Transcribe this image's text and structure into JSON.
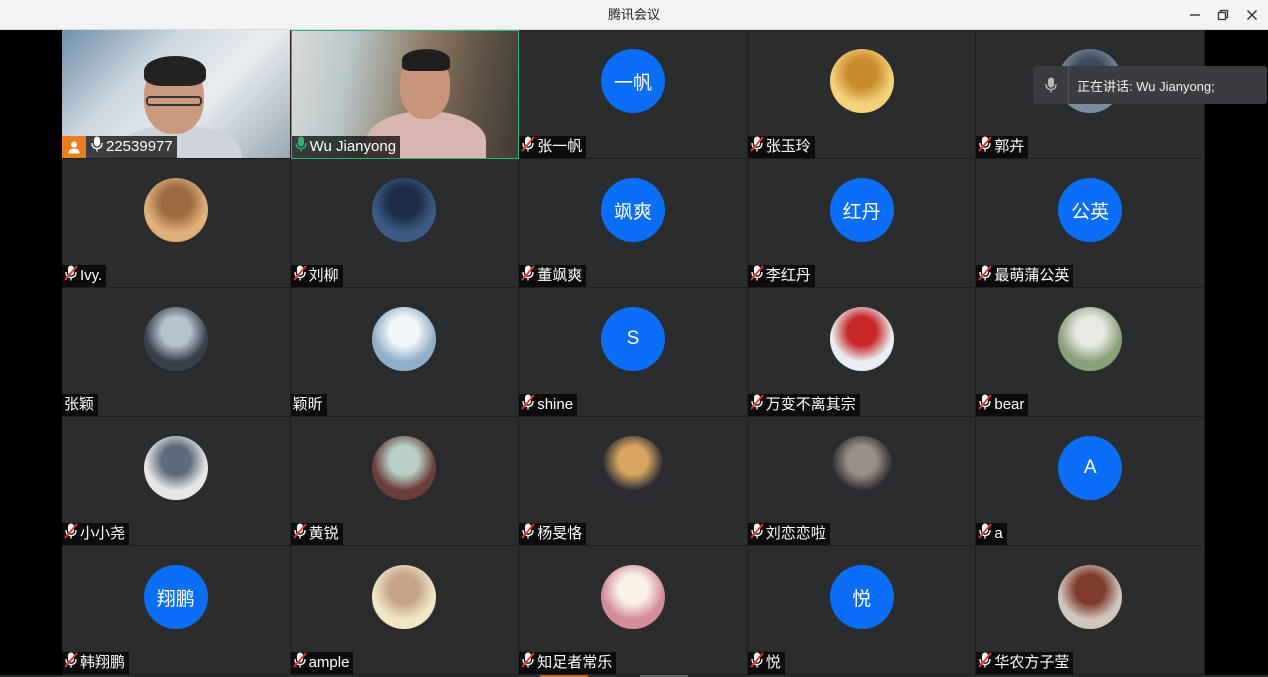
{
  "window": {
    "title": "腾讯会议"
  },
  "speaking": {
    "text": "正在讲话: Wu Jianyong;"
  },
  "colors": {
    "avatar_blue": "#0a6ef7",
    "host_badge": "#ef7c1b",
    "active_border": "#2fb36f"
  },
  "participants": [
    {
      "name": "22539977",
      "kind": "video",
      "mic": "on",
      "host": true
    },
    {
      "name": "Wu Jianyong",
      "kind": "video",
      "mic": "speaking"
    },
    {
      "name": "张一帆",
      "kind": "text",
      "avatar_text": "一帆",
      "mic": "muted"
    },
    {
      "name": "张玉玲",
      "kind": "image",
      "mic": "muted"
    },
    {
      "name": "郭卉",
      "kind": "image",
      "mic": "muted"
    },
    {
      "name": "Ivy.",
      "kind": "image",
      "mic": "muted"
    },
    {
      "name": "刘柳",
      "kind": "image",
      "mic": "muted"
    },
    {
      "name": "董飒爽",
      "kind": "text",
      "avatar_text": "飒爽",
      "mic": "muted"
    },
    {
      "name": "李红丹",
      "kind": "text",
      "avatar_text": "红丹",
      "mic": "muted"
    },
    {
      "name": "最萌蒲公英",
      "kind": "text",
      "avatar_text": "公英",
      "mic": "muted"
    },
    {
      "name": "张颖",
      "kind": "image",
      "mic": "none"
    },
    {
      "name": "颖昕",
      "kind": "image",
      "mic": "none"
    },
    {
      "name": "shine",
      "kind": "text",
      "avatar_text": "S",
      "mic": "muted"
    },
    {
      "name": "万变不离其宗",
      "kind": "image",
      "mic": "muted"
    },
    {
      "name": "bear",
      "kind": "image",
      "mic": "muted"
    },
    {
      "name": "小小尧",
      "kind": "image",
      "mic": "muted"
    },
    {
      "name": "黄锐",
      "kind": "image",
      "mic": "muted"
    },
    {
      "name": "杨旻恪",
      "kind": "image",
      "mic": "muted"
    },
    {
      "name": "刘恋恋啦",
      "kind": "image",
      "mic": "muted"
    },
    {
      "name": "a",
      "kind": "text",
      "avatar_text": "A",
      "mic": "muted"
    },
    {
      "name": "韩翔鹏",
      "kind": "text",
      "avatar_text": "翔鹏",
      "mic": "muted"
    },
    {
      "name": "ample",
      "kind": "image",
      "mic": "muted"
    },
    {
      "name": "知足者常乐",
      "kind": "image",
      "mic": "muted"
    },
    {
      "name": "悦",
      "kind": "text",
      "avatar_text": "悦",
      "mic": "muted"
    },
    {
      "name": "华农方子莹",
      "kind": "image",
      "mic": "muted"
    }
  ]
}
